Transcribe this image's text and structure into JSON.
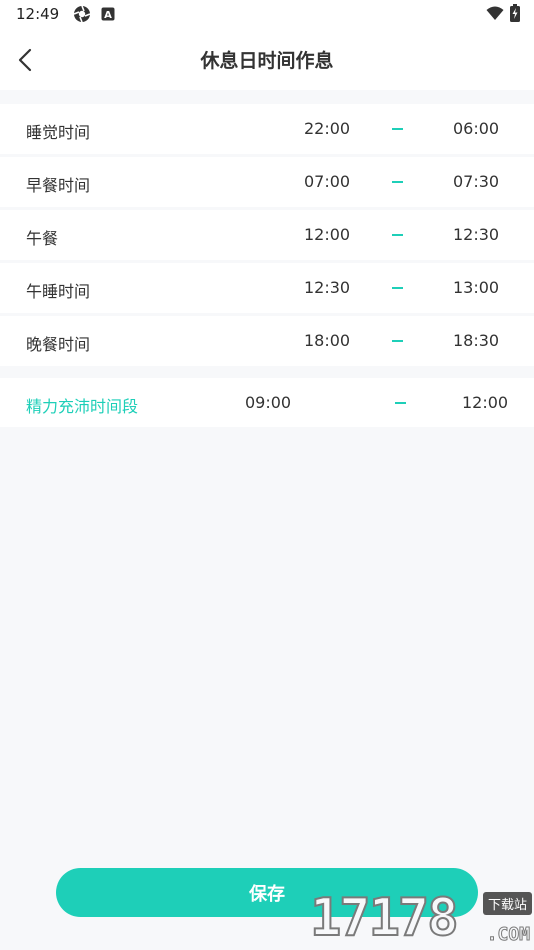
{
  "status_bar": {
    "time": "12:49",
    "icons_left": [
      "aperture-icon",
      "a-badge-icon"
    ],
    "a_badge_text": "A",
    "icons_right": [
      "wifi-icon",
      "battery-charging-icon"
    ]
  },
  "header": {
    "title": "休息日时间作息",
    "back_icon": "chevron-left-icon"
  },
  "schedule": [
    {
      "label": "睡觉时间",
      "start": "22:00",
      "end": "06:00"
    },
    {
      "label": "早餐时间",
      "start": "07:00",
      "end": "07:30"
    },
    {
      "label": "午餐",
      "start": "12:00",
      "end": "12:30"
    },
    {
      "label": "午睡时间",
      "start": "12:30",
      "end": "13:00"
    },
    {
      "label": "晚餐时间",
      "start": "18:00",
      "end": "18:30"
    }
  ],
  "energy": {
    "label": "精力充沛时间段",
    "start": "09:00",
    "end": "12:00"
  },
  "save_label": "保存",
  "colors": {
    "accent": "#1ecfb8",
    "background": "#f7f8fa",
    "text": "#333333"
  },
  "watermark": {
    "digits": "17178",
    "badge": "下载站",
    "domain": ".COM"
  }
}
